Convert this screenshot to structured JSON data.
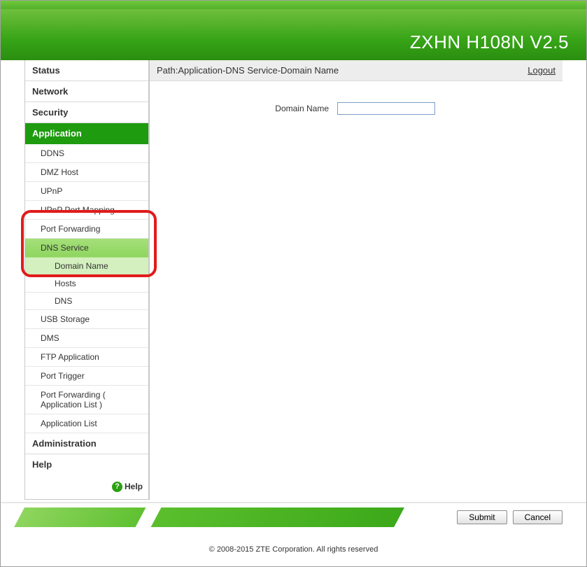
{
  "header": {
    "title": "ZXHN H108N V2.5"
  },
  "path": {
    "prefix": "Path:",
    "breadcrumb": "Application-DNS Service-Domain Name",
    "logout": "Logout"
  },
  "sidebar": {
    "groups": [
      {
        "label": "Status",
        "selected": false
      },
      {
        "label": "Network",
        "selected": false
      },
      {
        "label": "Security",
        "selected": false
      },
      {
        "label": "Application",
        "selected": true
      },
      {
        "label": "Administration",
        "selected": false
      },
      {
        "label": "Help",
        "selected": false
      }
    ],
    "app_subs": [
      {
        "label": "DDNS"
      },
      {
        "label": "DMZ Host"
      },
      {
        "label": "UPnP"
      },
      {
        "label": "UPnP Port Mapping"
      },
      {
        "label": "Port Forwarding"
      },
      {
        "label": "DNS Service",
        "active": true
      },
      {
        "label": "USB Storage"
      },
      {
        "label": "DMS"
      },
      {
        "label": "FTP Application"
      },
      {
        "label": "Port Trigger"
      },
      {
        "label": "Port Forwarding ( Application List )"
      },
      {
        "label": "Application List"
      }
    ],
    "dns_subs": [
      {
        "label": "Domain Name",
        "active": true
      },
      {
        "label": "Hosts"
      },
      {
        "label": "DNS"
      }
    ],
    "help": "Help"
  },
  "form": {
    "domain_label": "Domain Name",
    "domain_value": ""
  },
  "buttons": {
    "submit": "Submit",
    "cancel": "Cancel"
  },
  "footer": {
    "copyright": "© 2008-2015 ZTE Corporation. All rights reserved"
  }
}
